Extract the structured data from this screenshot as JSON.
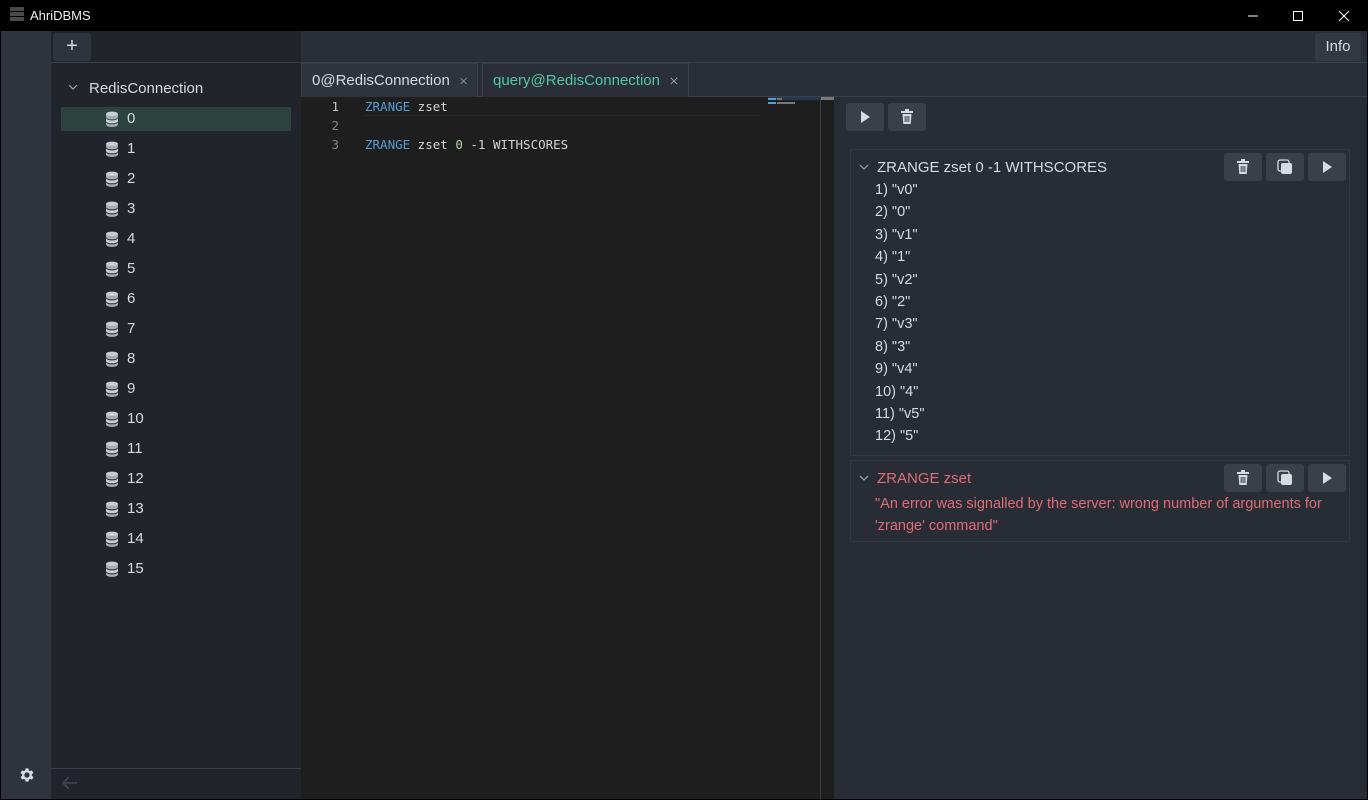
{
  "window": {
    "title": "AhriDBMS",
    "controls": [
      "minimize-icon",
      "maximize-icon",
      "close-icon"
    ]
  },
  "rail": {
    "settings_icon": "gear-icon"
  },
  "sidebar": {
    "add_label": "+",
    "connection": {
      "name": "RedisConnection",
      "expanded": true
    },
    "databases": [
      "0",
      "1",
      "2",
      "3",
      "4",
      "5",
      "6",
      "7",
      "8",
      "9",
      "10",
      "11",
      "12",
      "13",
      "14",
      "15"
    ],
    "selected_database": "0",
    "back_icon": "arrow-left-icon"
  },
  "header": {
    "info_label": "Info"
  },
  "tabs": [
    {
      "label": "0@RedisConnection",
      "active": false
    },
    {
      "label": "query@RedisConnection",
      "active": true
    }
  ],
  "editor": {
    "lines": [
      {
        "number": "1",
        "keyword": "ZRANGE",
        "rest": " zset",
        "number_arg": "",
        "tail": ""
      },
      {
        "number": "2",
        "keyword": "",
        "rest": "",
        "number_arg": "",
        "tail": ""
      },
      {
        "number": "3",
        "keyword": "ZRANGE",
        "rest": " zset ",
        "number_arg": "0",
        "tail": " -1 WITHSCORES"
      }
    ]
  },
  "results": {
    "toolbar": {
      "run_icon": "play-icon",
      "clear_icon": "trash-icon"
    },
    "cards": [
      {
        "command": "ZRANGE zset 0 -1 WITHSCORES",
        "status": "ok",
        "rows": [
          "1) \"v0\"",
          "2) \"0\"",
          "3) \"v1\"",
          "4) \"1\"",
          "5) \"v2\"",
          "6) \"2\"",
          "7) \"v3\"",
          "8) \"3\"",
          "9) \"v4\"",
          "10) \"4\"",
          "11) \"v5\"",
          "12) \"5\""
        ]
      },
      {
        "command": "ZRANGE zset",
        "status": "error",
        "error": "\"An error was signalled by the server: wrong number of arguments for 'zrange' command\""
      }
    ]
  },
  "colors": {
    "accent": "#4ec9a0",
    "error": "#e06c75",
    "keyword": "#569cd6",
    "number": "#b5cea8",
    "selected_item": "#2c423f"
  }
}
